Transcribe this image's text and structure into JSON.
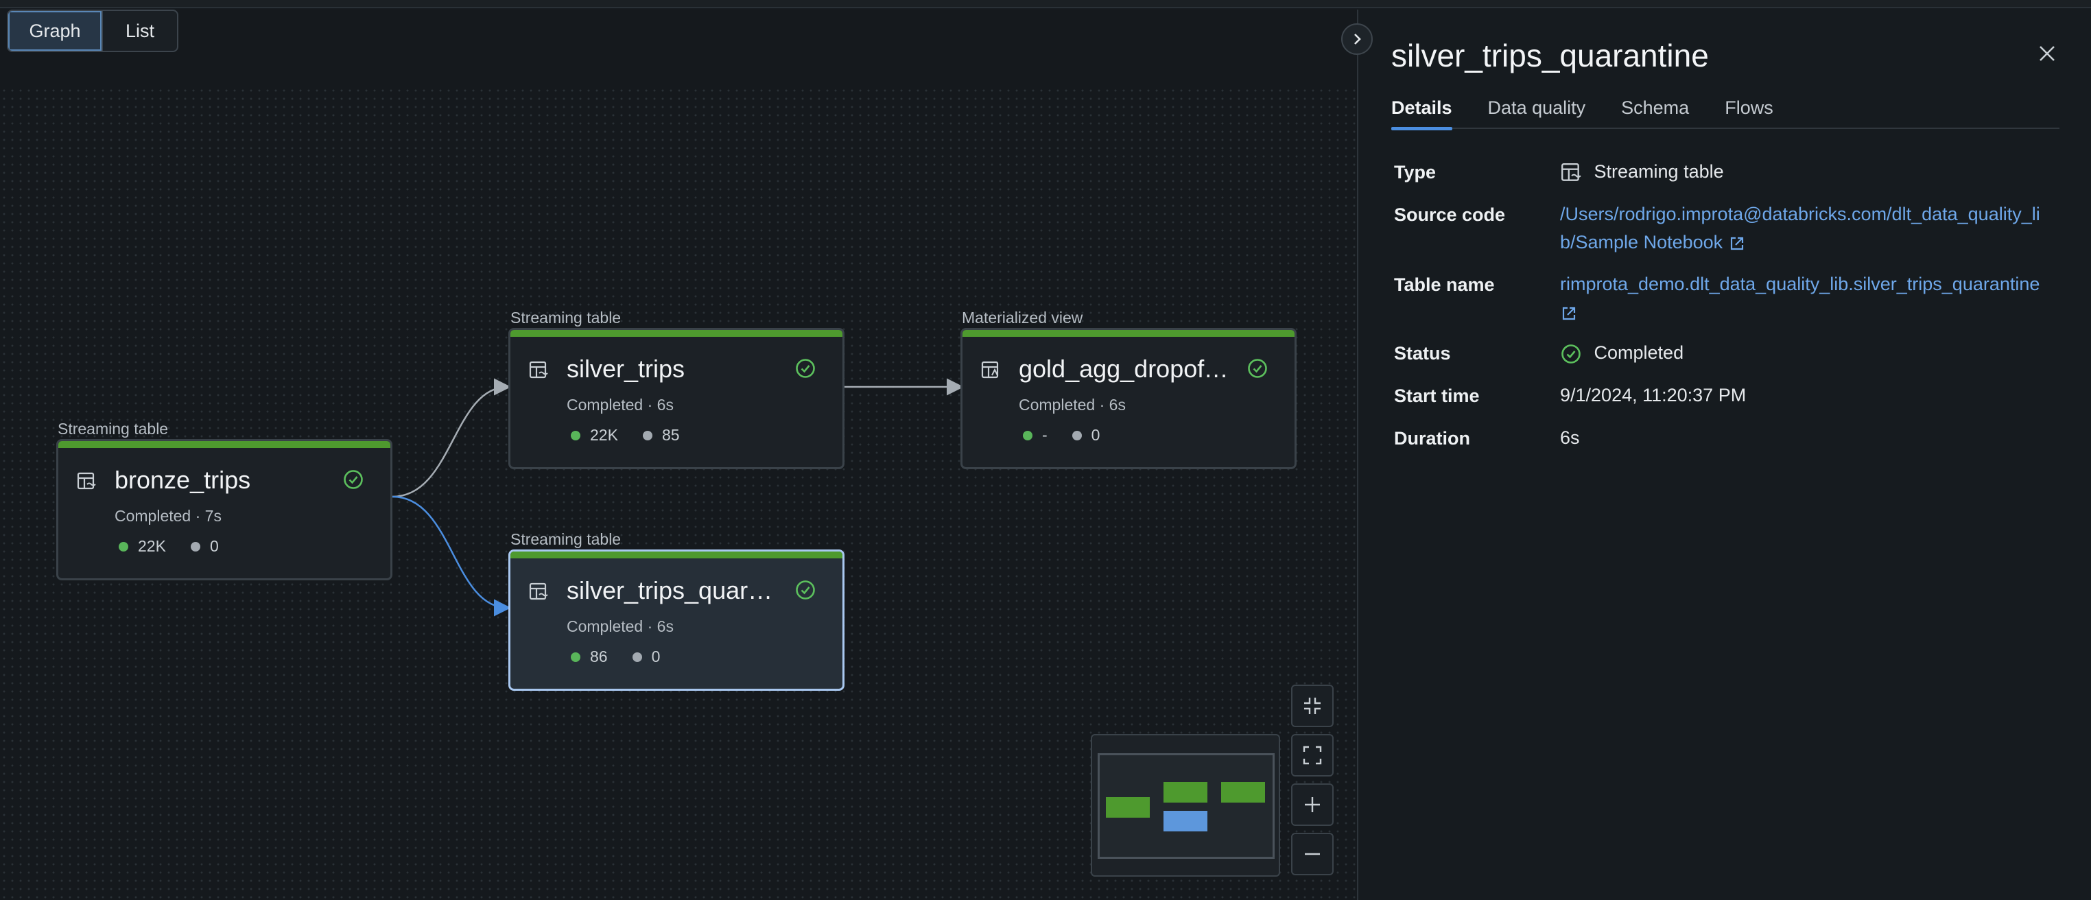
{
  "view_toggle": {
    "graph": "Graph",
    "list": "List"
  },
  "nodes": [
    {
      "id": "bronze",
      "type_label": "Streaming table",
      "title": "bronze_trips",
      "status": "Completed · 7s",
      "metric_green": "22K",
      "metric_grey": "0"
    },
    {
      "id": "silver",
      "type_label": "Streaming table",
      "title": "silver_trips",
      "status": "Completed · 6s",
      "metric_green": "22K",
      "metric_grey": "85"
    },
    {
      "id": "gold",
      "type_label": "Materialized view",
      "title": "gold_agg_dropoff…",
      "status": "Completed · 6s",
      "metric_green": "-",
      "metric_grey": "0"
    },
    {
      "id": "quarantine",
      "type_label": "Streaming table",
      "title": "silver_trips_quara…",
      "status": "Completed · 6s",
      "metric_green": "86",
      "metric_grey": "0"
    }
  ],
  "panel": {
    "title": "silver_trips_quarantine",
    "tabs": [
      "Details",
      "Data quality",
      "Schema",
      "Flows"
    ],
    "details": {
      "type_label": "Type",
      "type_value": "Streaming table",
      "source_label": "Source code",
      "source_value": "/Users/rodrigo.improta@databricks.com/dlt_data_quality_lib/Sample Notebook",
      "table_label": "Table name",
      "table_value": "rimprota_demo.dlt_data_quality_lib.silver_trips_quarantine",
      "status_label": "Status",
      "status_value": "Completed",
      "start_label": "Start time",
      "start_value": "9/1/2024, 11:20:37 PM",
      "duration_label": "Duration",
      "duration_value": "6s"
    }
  },
  "colors": {
    "success": "#4e9a2e",
    "selected": "#a9c8f0",
    "link": "#6fa8ea",
    "edge_selected": "#4b8ee0"
  },
  "icons": [
    "streaming-table-icon",
    "check-circle-icon",
    "chevron-right-icon",
    "close-icon",
    "external-link-icon",
    "fit-view-icon",
    "fullscreen-icon",
    "zoom-in-icon",
    "zoom-out-icon"
  ]
}
